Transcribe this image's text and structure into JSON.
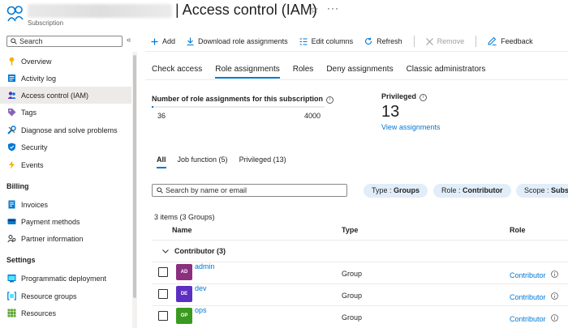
{
  "header": {
    "resource_type": "Subscription",
    "title": "| Access control (IAM)",
    "star_icon": "☆",
    "more_icon": "···"
  },
  "sidebar": {
    "search_placeholder": "Search",
    "collapse_icon": "«",
    "items": [
      {
        "label": "Overview",
        "icon": "key-icon",
        "active": false
      },
      {
        "label": "Activity log",
        "icon": "activity-log-icon",
        "active": false
      },
      {
        "label": "Access control (IAM)",
        "icon": "people-icon",
        "active": true
      },
      {
        "label": "Tags",
        "icon": "tag-icon",
        "active": false
      },
      {
        "label": "Diagnose and solve problems",
        "icon": "wrench-icon",
        "active": false
      },
      {
        "label": "Security",
        "icon": "shield-icon",
        "active": false
      },
      {
        "label": "Events",
        "icon": "lightning-icon",
        "active": false
      }
    ],
    "billing_header": "Billing",
    "billing_items": [
      {
        "label": "Invoices",
        "icon": "invoice-icon"
      },
      {
        "label": "Payment methods",
        "icon": "payment-icon"
      },
      {
        "label": "Partner information",
        "icon": "partner-icon"
      }
    ],
    "settings_header": "Settings",
    "settings_items": [
      {
        "label": "Programmatic deployment",
        "icon": "deployment-icon"
      },
      {
        "label": "Resource groups",
        "icon": "resource-groups-icon"
      },
      {
        "label": "Resources",
        "icon": "grid-icon"
      }
    ]
  },
  "toolbar": {
    "add": "Add",
    "download": "Download role assignments",
    "edit_columns": "Edit columns",
    "refresh": "Refresh",
    "remove": "Remove",
    "feedback": "Feedback"
  },
  "tabs": [
    "Check access",
    "Role assignments",
    "Roles",
    "Deny assignments",
    "Classic administrators"
  ],
  "active_tab": "Role assignments",
  "stats": {
    "assignments_label": "Number of role assignments for this subscription",
    "current": "36",
    "max": "4000",
    "fraction": 0.009,
    "privileged_label": "Privileged",
    "privileged_count": "13",
    "view_link": "View assignments"
  },
  "subtabs": [
    "All",
    "Job function (5)",
    "Privileged (13)"
  ],
  "filters": {
    "search_placeholder": "Search by name or email",
    "pills": [
      {
        "key": "Type : ",
        "value": "Groups"
      },
      {
        "key": "Role : ",
        "value": "Contributor"
      },
      {
        "key": "Scope : ",
        "value": "Subscription"
      }
    ]
  },
  "table": {
    "count": "3 items (3 Groups)",
    "headers": {
      "name": "Name",
      "type": "Type",
      "role": "Role"
    },
    "group": "Contributor (3)",
    "rows": [
      {
        "initials": "AD",
        "name": "admin",
        "type": "Group",
        "role": "Contributor",
        "color": "#8b2f7f"
      },
      {
        "initials": "DE",
        "name": "dev",
        "type": "Group",
        "role": "Contributor",
        "color": "#5c2fc2"
      },
      {
        "initials": "OP",
        "name": "ops",
        "type": "Group",
        "role": "Contributor",
        "color": "#3a9a1e"
      }
    ]
  },
  "colors": {
    "accent": "#0078d4",
    "pill_bg": "#e1eef9",
    "active_nav": "#edebe9"
  }
}
